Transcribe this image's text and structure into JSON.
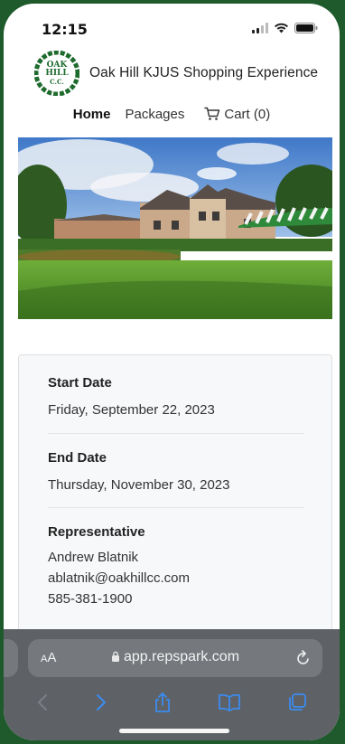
{
  "status_bar": {
    "time": "12:15"
  },
  "header": {
    "logo_lines": [
      "OAK",
      "HILL",
      "C.C."
    ],
    "title": "Oak Hill KJUS Shopping Experience"
  },
  "nav": {
    "items": [
      {
        "label": "Home",
        "active": true
      },
      {
        "label": "Packages",
        "active": false
      }
    ],
    "cart_label": "Cart (0)"
  },
  "details": {
    "start": {
      "label": "Start Date",
      "value": "Friday, September 22, 2023"
    },
    "end": {
      "label": "End Date",
      "value": "Thursday, November 30, 2023"
    },
    "rep": {
      "label": "Representative",
      "name": "Andrew Blatnik",
      "email": "ablatnik@oakhillcc.com",
      "phone": "585-381-1900"
    }
  },
  "browser": {
    "aa_label": "AA",
    "url": "app.repspark.com"
  },
  "colors": {
    "frame_green": "#1e5a2c",
    "logo_green": "#1e6b2e",
    "browser_gray": "#5e6266",
    "toolbar_blue": "#3b8bf0"
  }
}
